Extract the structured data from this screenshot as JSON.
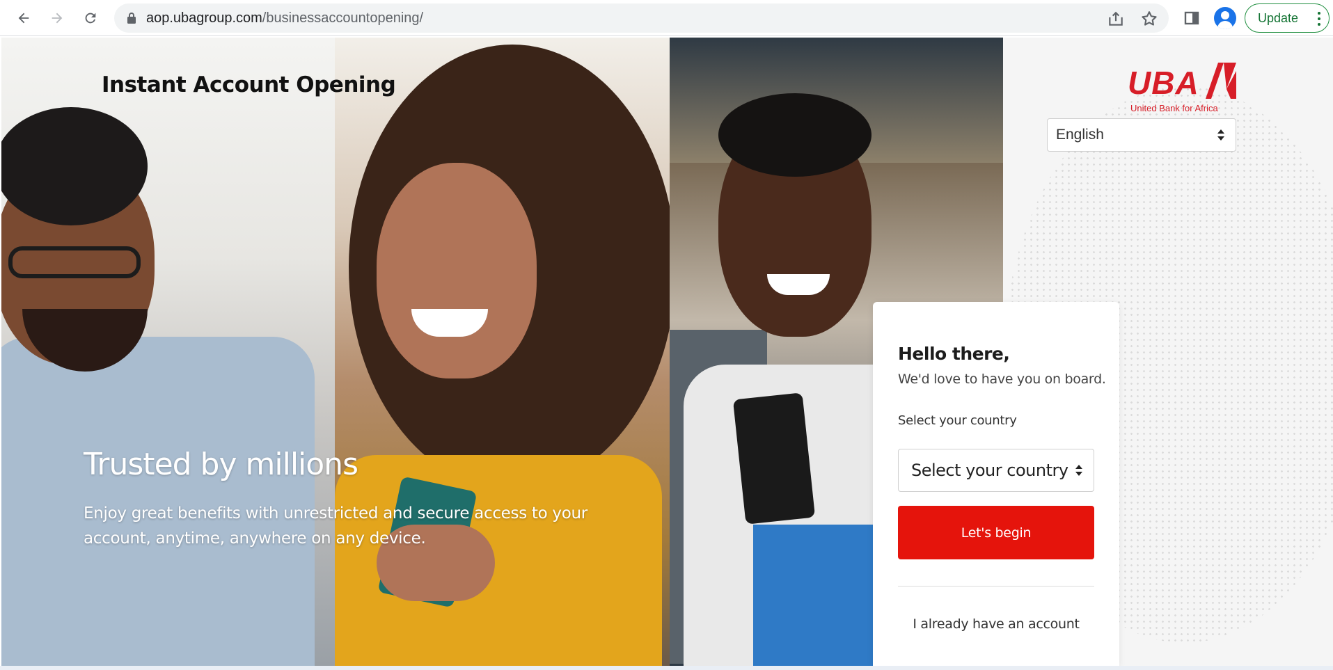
{
  "browser": {
    "url_domain": "aop.ubagroup.com",
    "url_path": "/businessaccountopening/",
    "update_label": "Update",
    "icons": [
      "back-arrow-icon",
      "forward-arrow-icon",
      "reload-icon",
      "lock-icon",
      "share-icon",
      "star-icon",
      "side-panel-icon",
      "profile-avatar",
      "more-vert-icon"
    ]
  },
  "page": {
    "title": "Instant Account Opening",
    "hero_heading": "Trusted by millions",
    "hero_text": "Enjoy great benefits with unrestricted and secure access to your account, anytime, anywhere on any device."
  },
  "brand": {
    "logo_word": "UBA",
    "tagline": "United Bank for Africa",
    "color": "#d71e28"
  },
  "language": {
    "selected": "English"
  },
  "card": {
    "title": "Hello there,",
    "subtitle": "We'd love to have you on board.",
    "country_label": "Select your country",
    "country_selected": "Select your country",
    "begin_label": "Let's begin",
    "existing_account_label": "I already have an account",
    "button_color": "#e5140c"
  }
}
